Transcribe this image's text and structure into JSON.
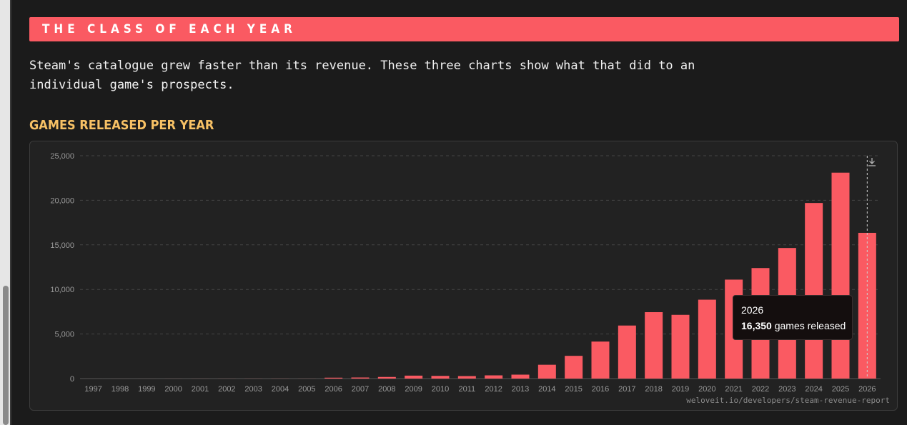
{
  "section": {
    "title": "THE CLASS OF EACH YEAR"
  },
  "intro": {
    "line1": "Steam's catalogue grew faster than its revenue. These three charts show what that did to an",
    "line2": "individual game's prospects."
  },
  "colors": {
    "accent": "#fa5a62",
    "title_gold": "#f7c165",
    "bar": "#fa5a62"
  },
  "icons": {
    "download": "download-icon"
  },
  "tooltip": {
    "year": "2026",
    "value": "16,350",
    "suffix": " games released"
  },
  "source": "weloveit.io/developers/steam-revenue-report",
  "chart_data": {
    "type": "bar",
    "title": "GAMES RELEASED PER YEAR",
    "categories": [
      "1997",
      "1998",
      "1999",
      "2000",
      "2001",
      "2002",
      "2003",
      "2004",
      "2005",
      "2006",
      "2007",
      "2008",
      "2009",
      "2010",
      "2011",
      "2012",
      "2013",
      "2014",
      "2015",
      "2016",
      "2017",
      "2018",
      "2019",
      "2020",
      "2021",
      "2022",
      "2023",
      "2024",
      "2025",
      "2026"
    ],
    "values": [
      1,
      2,
      2,
      3,
      4,
      5,
      7,
      8,
      6,
      100,
      120,
      180,
      330,
      300,
      280,
      360,
      440,
      1550,
      2550,
      4150,
      5950,
      7450,
      7150,
      8850,
      11100,
      12400,
      14650,
      19700,
      23100,
      16350
    ],
    "ylim": [
      0,
      25000
    ],
    "yticks": [
      0,
      5000,
      10000,
      15000,
      20000,
      25000
    ],
    "ytick_labels": [
      "0",
      "5,000",
      "10,000",
      "15,000",
      "20,000",
      "25,000"
    ],
    "grid": true,
    "highlight_category": "2026"
  }
}
